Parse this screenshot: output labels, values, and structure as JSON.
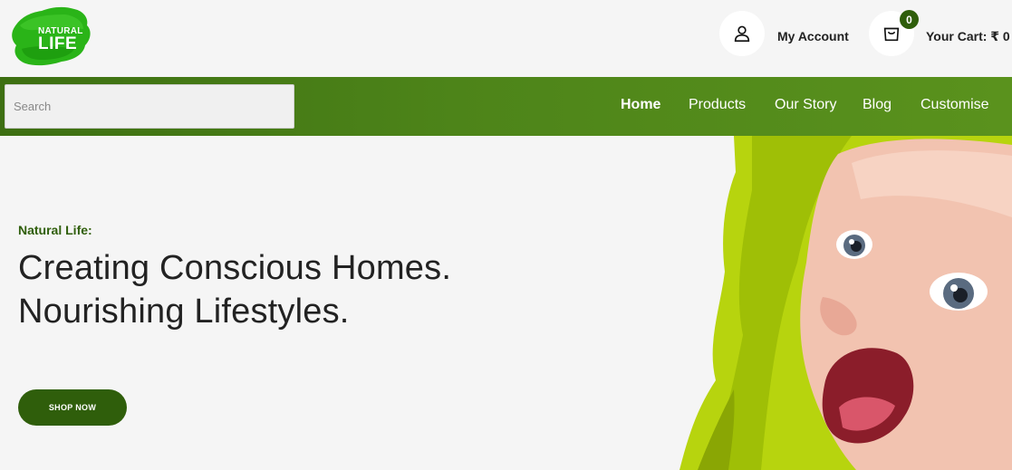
{
  "header": {
    "logo_line1": "NATURAL",
    "logo_line2": "LIFE",
    "account_label": "My Account",
    "cart_count": "0",
    "cart_label": "Your Cart: ₹ 0"
  },
  "search": {
    "placeholder": "Search",
    "value": ""
  },
  "nav": {
    "items": [
      {
        "label": "Home",
        "active": true
      },
      {
        "label": "Products"
      },
      {
        "label": "Our Story"
      },
      {
        "label": "Blog"
      },
      {
        "label": "Customise"
      }
    ]
  },
  "hero": {
    "eyebrow": "Natural Life:",
    "headline_line1": "Creating Conscious Homes.",
    "headline_line2": "Nourishing Lifestyles.",
    "cta_label": "SHOP NOW"
  },
  "colors": {
    "brand_green_dark": "#2f5e0b",
    "nav_green": "#4d8419",
    "logo_green": "#22b014",
    "background": "#f5f5f5"
  },
  "icons": {
    "account": "user-icon",
    "cart": "shopping-bag-icon"
  }
}
